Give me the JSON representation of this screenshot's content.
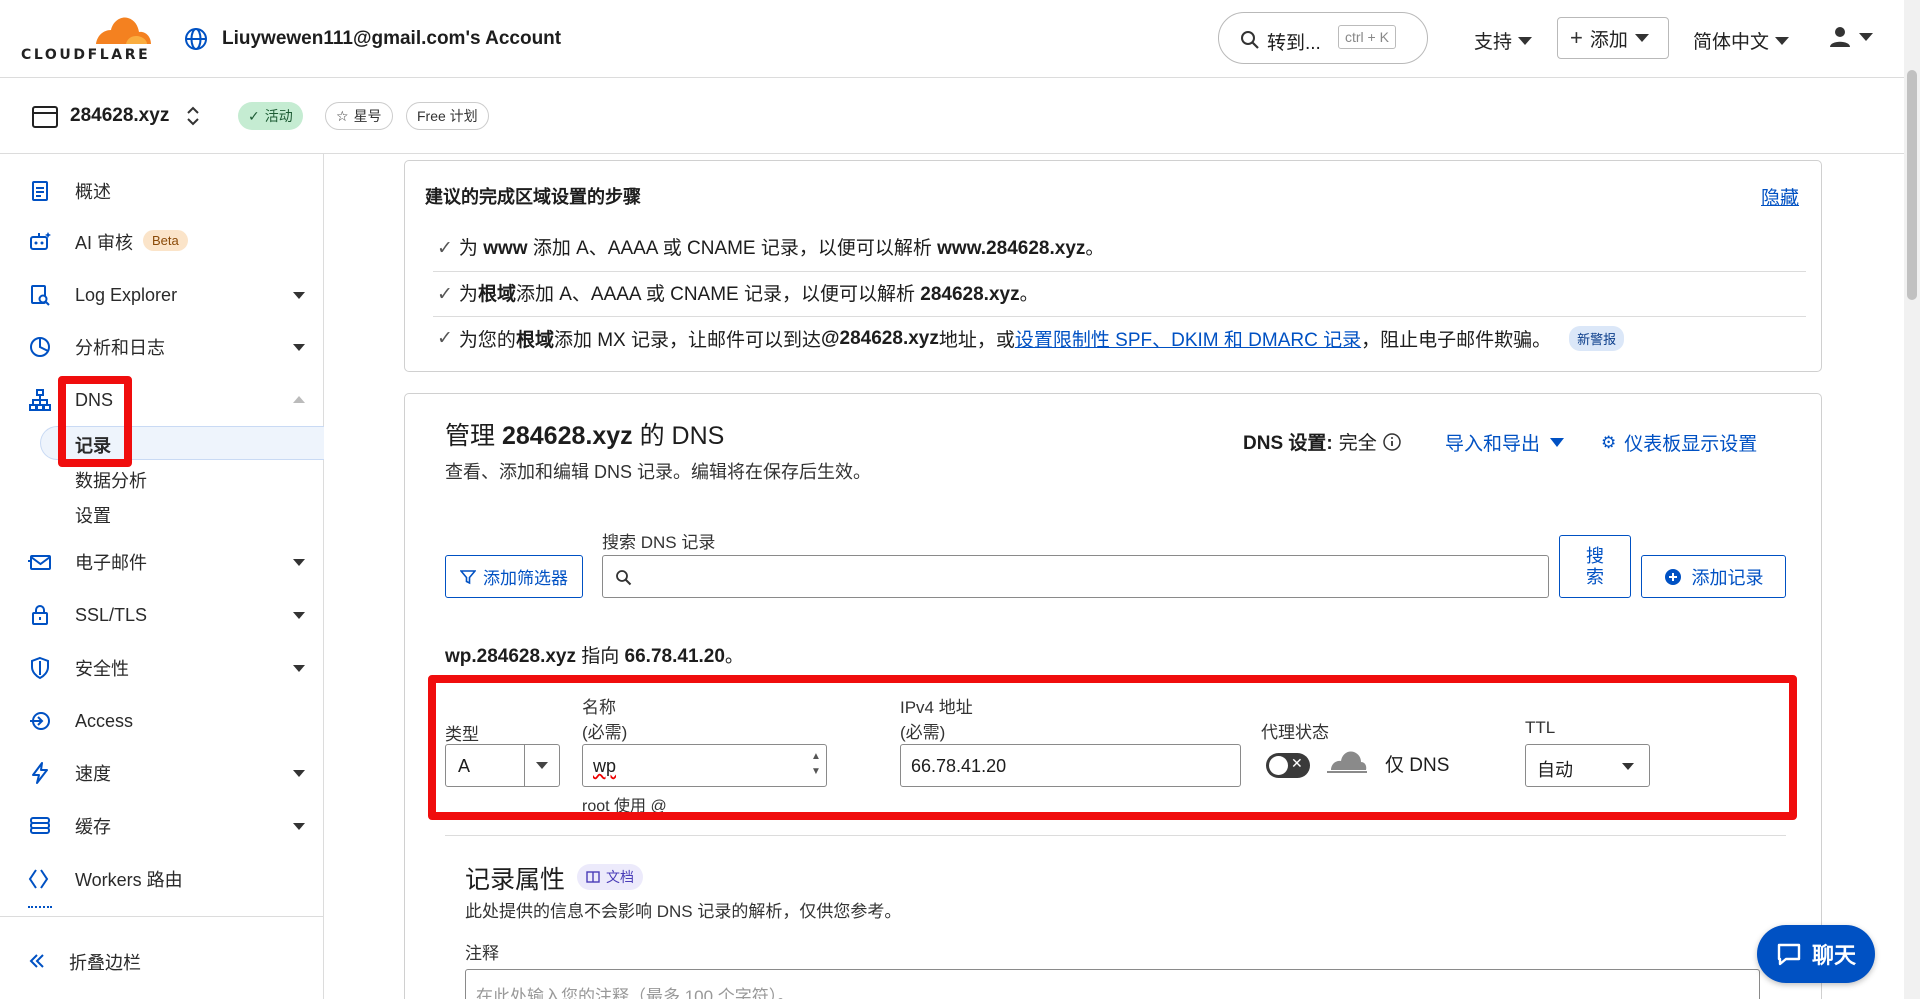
{
  "header": {
    "logo_text": "CLOUDFLARE",
    "account": "Liuywewen111@gmail.com's Account",
    "goto_label": "转到...",
    "goto_shortcut": "ctrl + K",
    "support_label": "支持",
    "add_label": "添加",
    "language_label": "简体中文"
  },
  "zone": {
    "domain": "284628.xyz",
    "status": "活动",
    "star": "星号",
    "plan": "Free 计划"
  },
  "sidebar": {
    "items": [
      {
        "label": "概述"
      },
      {
        "label": "AI 审核",
        "badge": "Beta"
      },
      {
        "label": "Log Explorer"
      },
      {
        "label": "分析和日志"
      },
      {
        "label": "DNS"
      },
      {
        "label": "电子邮件"
      },
      {
        "label": "SSL/TLS"
      },
      {
        "label": "安全性"
      },
      {
        "label": "Access"
      },
      {
        "label": "速度"
      },
      {
        "label": "缓存"
      },
      {
        "label": "Workers 路由"
      }
    ],
    "dns_sub": [
      "记录",
      "数据分析",
      "设置"
    ],
    "collapse_label": "折叠边栏"
  },
  "setup": {
    "title": "建议的完成区域设置的步骤",
    "hide_label": "隐藏",
    "step1_a": "为 ",
    "step1_b": "www",
    "step1_c": " 添加 A、AAAA 或 CNAME 记录，以便可以解析 ",
    "step1_d": "www.284628.xyz",
    "step1_e": "。",
    "step2_a": "为",
    "step2_b": "根域",
    "step2_c": "添加 A、AAAA 或 CNAME 记录，以便可以解析 ",
    "step2_d": "284628.xyz",
    "step2_e": "。",
    "step3_a": "为您的",
    "step3_b": "根域",
    "step3_c": "添加 MX 记录，让邮件可以到达 ",
    "step3_d": "@284628.xyz",
    "step3_e": " 地址，或",
    "step3_link": "设置限制性 SPF、DKIM 和 DMARC 记录",
    "step3_f": "，阻止电子邮件欺骗。",
    "step3_badge": "新警报"
  },
  "dns": {
    "title_a": "管理 ",
    "title_b": "284628.xyz",
    "title_c": " 的 DNS",
    "subtitle": "查看、添加和编辑 DNS 记录。编辑将在保存后生效。",
    "settings_label": "DNS 设置:",
    "settings_value": "完全",
    "import_export": "导入和导出",
    "dashboard_settings": "仪表板显示设置",
    "search_label": "搜索 DNS 记录",
    "add_filter": "添加筛选器",
    "search_button": "搜索",
    "add_record": "添加记录",
    "points_a": "wp.284628.xyz",
    "points_b": " 指向 ",
    "points_c": "66.78.41.20",
    "points_d": "。"
  },
  "form": {
    "type_label": "类型",
    "type_value": "A",
    "name_label": "名称",
    "name_required": "(必需)",
    "name_value": "wp",
    "name_hint": "root 使用 @",
    "ipv4_label": "IPv4 地址",
    "ipv4_required": "(必需)",
    "ipv4_value": "66.78.41.20",
    "proxy_label": "代理状态",
    "proxy_value": "仅 DNS",
    "proxy_enabled": false,
    "ttl_label": "TTL",
    "ttl_value": "自动"
  },
  "attributes": {
    "title": "记录属性",
    "docs_label": "文档",
    "desc": "此处提供的信息不会影响 DNS 记录的解析，仅供您参考。",
    "comment_label": "注释",
    "comment_placeholder": "在此处输入您的注释（最多 100 个字符）。"
  },
  "chat": {
    "label": "聊天"
  },
  "colors": {
    "accent": "#0051c3",
    "logo_orange": "#f48120",
    "highlight_red": "#f00d0d",
    "status_green": "#c5ecd2"
  }
}
